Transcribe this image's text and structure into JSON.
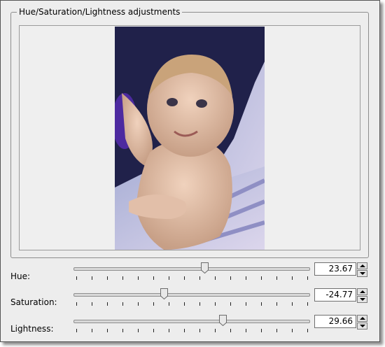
{
  "window": {
    "group_title": "Hue/Saturation/Lightness adjustments"
  },
  "preview": {
    "image_subject": "baby-photo"
  },
  "controls": [
    {
      "label": "Hue:",
      "value": "23.67",
      "slider_fraction": 0.56
    },
    {
      "label": "Saturation:",
      "value": "-24.77",
      "slider_fraction": 0.38
    },
    {
      "label": "Lightness:",
      "value": "29.66",
      "slider_fraction": 0.64
    }
  ],
  "colors": {
    "dialog_bg": "#ededed",
    "border": "#8d8d8d"
  }
}
